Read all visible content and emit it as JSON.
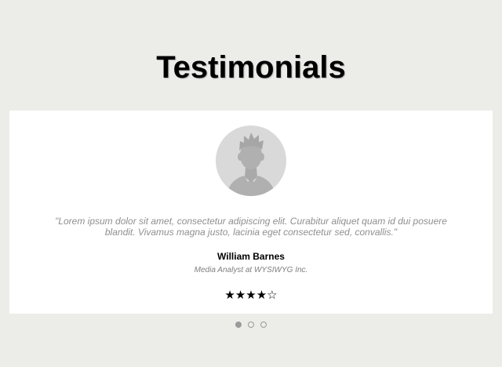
{
  "section": {
    "title": "Testimonials"
  },
  "testimonial": {
    "avatar_icon": "user-silhouette-icon",
    "quote": "\"Lorem ipsum dolor sit amet, consectetur adipiscing elit. Curabitur aliquet quam id dui posuere blandit. Vivamus magna justo, lacinia eget consectetur sed, convallis.\"",
    "name": "William Barnes",
    "role": "Media Analyst at WYSIWYG Inc.",
    "rating": 4,
    "rating_max": 5,
    "star_filled_glyph": "★",
    "star_empty_glyph": "☆"
  },
  "pagination": {
    "count": 3,
    "active_index": 0
  },
  "colors": {
    "page_background": "#ecede9",
    "card_background": "#ffffff",
    "avatar_background": "#d9d9d9",
    "avatar_silhouette": "#b0b0b0",
    "dot_color": "#9a9a9a"
  }
}
